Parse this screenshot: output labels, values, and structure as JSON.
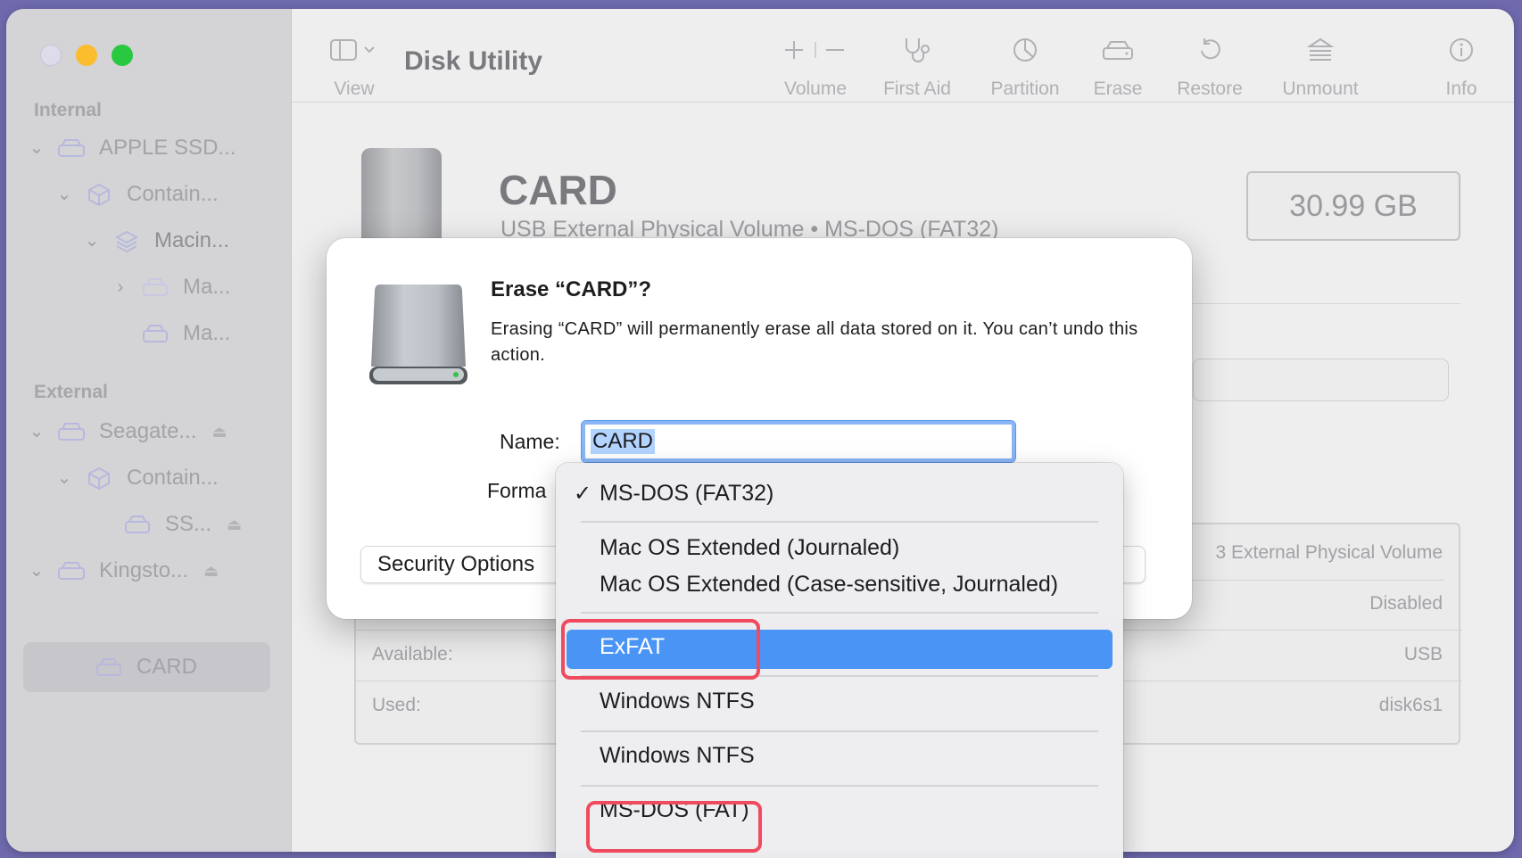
{
  "app": {
    "title": "Disk Utility"
  },
  "toolbar": {
    "view": "View",
    "volume": "Volume",
    "first_aid": "First Aid",
    "partition": "Partition",
    "erase": "Erase",
    "restore": "Restore",
    "unmount": "Unmount",
    "info": "Info"
  },
  "sidebar": {
    "internal_header": "Internal",
    "external_header": "External",
    "items": [
      {
        "label": "APPLE SSD..."
      },
      {
        "label": "Contain..."
      },
      {
        "label": "Macin..."
      },
      {
        "label": "Ma..."
      },
      {
        "label": "Ma..."
      },
      {
        "label": "Seagate..."
      },
      {
        "label": "Contain..."
      },
      {
        "label": "SS..."
      },
      {
        "label": "Kingsto..."
      },
      {
        "label": "CARD"
      }
    ]
  },
  "volume": {
    "name": "CARD",
    "subtitle": "USB External Physical Volume • MS-DOS (FAT32)",
    "size": "30.99 GB"
  },
  "info_panel": {
    "rows": [
      {
        "label": "",
        "value": "3 External Physical Volume"
      },
      {
        "label": "",
        "value": "Disabled"
      },
      {
        "label": "Available:",
        "value": "USB"
      },
      {
        "label": "Used:",
        "value": "disk6s1"
      }
    ]
  },
  "dialog": {
    "title": "Erase “CARD”?",
    "message": "Erasing “CARD” will permanently erase all data stored on it. You can’t undo this action.",
    "name_label": "Name:",
    "name_value": "CARD",
    "format_label": "Forma",
    "security_button": "Security Options"
  },
  "format_menu": {
    "selected": "MS-DOS (FAT32)",
    "items": [
      "MS-DOS (FAT32)",
      "Mac OS Extended (Journaled)",
      "Mac OS Extended (Case-sensitive, Journaled)",
      "ExFAT",
      "Windows NTFS",
      "Windows NTFS",
      "MS-DOS (FAT)"
    ],
    "highlighted": "ExFAT"
  },
  "colors": {
    "highlight": "#4a94f5",
    "callout": "#ef4a5e",
    "background": "#6f6aae"
  }
}
